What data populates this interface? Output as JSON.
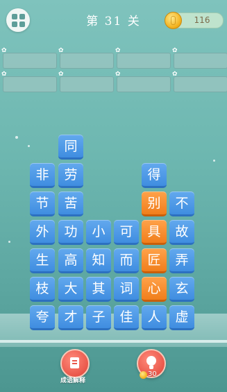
{
  "header": {
    "title": "第 31 关",
    "coins": "116"
  },
  "answer_slots": {
    "rows": 2,
    "per_row": 4,
    "filled": []
  },
  "grid": {
    "columns": [
      [
        "夸",
        "枝",
        "生",
        "外",
        "节",
        "非"
      ],
      [
        "才",
        "大",
        "高",
        "功",
        "苦",
        "劳",
        "同"
      ],
      [
        "子",
        "其",
        "知",
        "小"
      ],
      [
        "佳",
        "词",
        "而",
        "可"
      ],
      [
        "人",
        "心",
        "匠",
        "具",
        "别",
        "得"
      ],
      [
        "虚",
        "玄",
        "弄",
        "故",
        "不"
      ]
    ],
    "highlighted": [
      [
        4,
        1
      ],
      [
        4,
        2
      ],
      [
        4,
        3
      ],
      [
        4,
        4
      ]
    ],
    "highlight_color": "#f08a2a",
    "tile_color": "#4a94e4"
  },
  "footer": {
    "explain_label": "成语解释",
    "hint_cost": "30",
    "explain_icon": "book-icon",
    "hint_icon": "lightbulb-icon"
  }
}
